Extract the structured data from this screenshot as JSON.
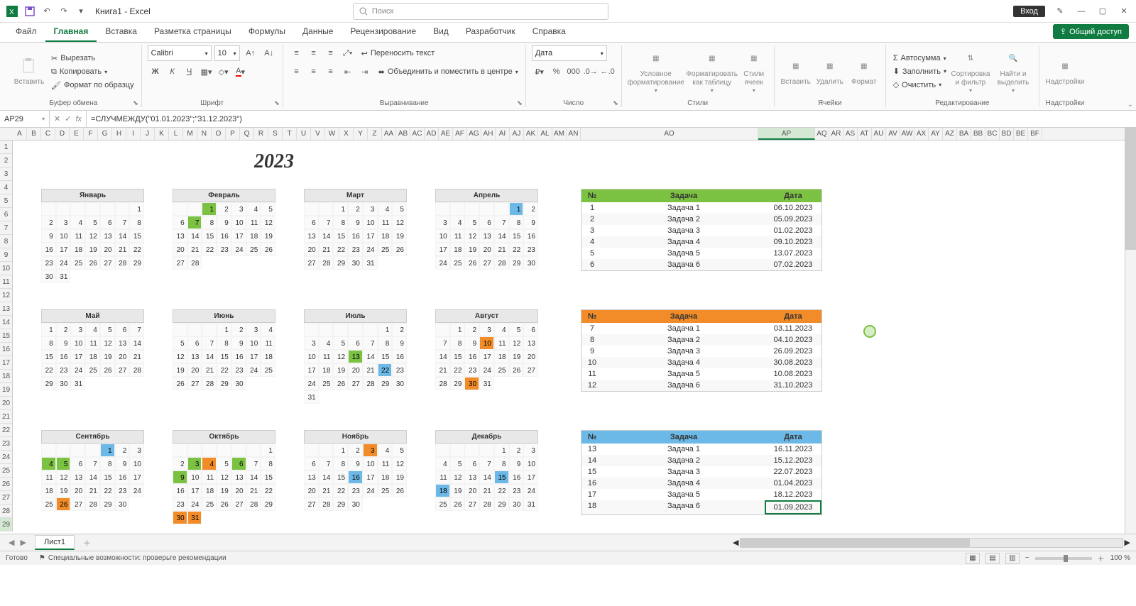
{
  "title": "Книга1 - Excel",
  "search_placeholder": "Поиск",
  "sign_in": "Вход",
  "tabs": [
    "Файл",
    "Главная",
    "Вставка",
    "Разметка страницы",
    "Формулы",
    "Данные",
    "Рецензирование",
    "Вид",
    "Разработчик",
    "Справка"
  ],
  "active_tab": "Главная",
  "share": "Общий доступ",
  "clipboard": {
    "paste": "Вставить",
    "cut": "Вырезать",
    "copy": "Копировать",
    "format_painter": "Формат по образцу",
    "label": "Буфер обмена"
  },
  "font": {
    "name": "Calibri",
    "size": "10",
    "label": "Шрифт"
  },
  "alignment": {
    "wrap": "Переносить текст",
    "merge": "Объединить и поместить в центре",
    "label": "Выравнивание"
  },
  "number": {
    "format": "Дата",
    "label": "Число"
  },
  "styles": {
    "conditional": "Условное форматирование",
    "table": "Форматировать как таблицу",
    "cell": "Стили ячеек",
    "label": "Стили"
  },
  "cells": {
    "insert": "Вставить",
    "delete": "Удалить",
    "format": "Формат",
    "label": "Ячейки"
  },
  "editing": {
    "autosum": "Автосумма",
    "fill": "Заполнить",
    "clear": "Очистить",
    "sort": "Сортировка и фильтр",
    "find": "Найти и выделить",
    "label": "Редактирование"
  },
  "addins": {
    "btn": "Надстройки",
    "label": "Надстройки"
  },
  "name_box": "AP29",
  "formula": "=СЛУЧМЕЖДУ(\"01.01.2023\";\"31.12.2023\")",
  "year": "2023",
  "col_letters_narrow": [
    "A",
    "B",
    "C",
    "D",
    "E",
    "F",
    "G",
    "H",
    "I",
    "J",
    "K",
    "L",
    "M",
    "N",
    "O",
    "P",
    "Q",
    "R",
    "S",
    "T",
    "U",
    "V",
    "W",
    "X",
    "Y",
    "Z",
    "AA",
    "AB",
    "AC",
    "AD",
    "AE",
    "AF",
    "AG",
    "AH",
    "AI",
    "AJ",
    "AK",
    "AL",
    "AM",
    "AN"
  ],
  "col_wide": [
    "AO",
    "AP"
  ],
  "col_after": [
    "AQ",
    "AR",
    "AS",
    "AT",
    "AU",
    "AV",
    "AW",
    "AX",
    "AY",
    "AZ",
    "BA",
    "BB",
    "BC",
    "BD",
    "BE",
    "BF"
  ],
  "active_col": "AP",
  "row_count": 29,
  "active_row": 29,
  "months": [
    {
      "name": "Январь",
      "start": 6,
      "days": 31,
      "hl": {}
    },
    {
      "name": "Февраль",
      "start": 2,
      "days": 28,
      "hl": {
        "1": "green",
        "7": "green"
      }
    },
    {
      "name": "Март",
      "start": 2,
      "days": 31,
      "hl": {}
    },
    {
      "name": "Апрель",
      "start": 5,
      "days": 30,
      "hl": {
        "1": "blue"
      }
    },
    {
      "name": "Май",
      "start": 0,
      "days": 31,
      "hl": {}
    },
    {
      "name": "Июнь",
      "start": 3,
      "days": 30,
      "hl": {}
    },
    {
      "name": "Июль",
      "start": 5,
      "days": 31,
      "hl": {
        "13": "green",
        "22": "blue"
      }
    },
    {
      "name": "Август",
      "start": 1,
      "days": 31,
      "hl": {
        "10": "orange",
        "30": "orange"
      }
    },
    {
      "name": "Сентябрь",
      "start": 4,
      "days": 30,
      "hl": {
        "1": "blue",
        "4": "green",
        "5": "green",
        "26": "orange"
      }
    },
    {
      "name": "Октябрь",
      "start": 6,
      "days": 31,
      "hl": {
        "3": "green",
        "4": "orange",
        "6": "green",
        "9": "green",
        "30": "orange",
        "31": "orange"
      }
    },
    {
      "name": "Ноябрь",
      "start": 2,
      "days": 30,
      "hl": {
        "3": "orange",
        "16": "blue"
      }
    },
    {
      "name": "Декабрь",
      "start": 4,
      "days": 31,
      "hl": {
        "15": "blue",
        "18": "blue"
      }
    }
  ],
  "task_headers": {
    "num": "№",
    "task": "Задача",
    "date": "Дата"
  },
  "task_tables": [
    {
      "color": "green",
      "rows": [
        {
          "n": "1",
          "t": "Задача 1",
          "d": "06.10.2023"
        },
        {
          "n": "2",
          "t": "Задача 2",
          "d": "05.09.2023"
        },
        {
          "n": "3",
          "t": "Задача 3",
          "d": "01.02.2023"
        },
        {
          "n": "4",
          "t": "Задача 4",
          "d": "09.10.2023"
        },
        {
          "n": "5",
          "t": "Задача 5",
          "d": "13.07.2023"
        },
        {
          "n": "6",
          "t": "Задача 6",
          "d": "07.02.2023"
        }
      ]
    },
    {
      "color": "orange",
      "rows": [
        {
          "n": "7",
          "t": "Задача 1",
          "d": "03.11.2023"
        },
        {
          "n": "8",
          "t": "Задача 2",
          "d": "04.10.2023"
        },
        {
          "n": "9",
          "t": "Задача 3",
          "d": "26.09.2023"
        },
        {
          "n": "10",
          "t": "Задача 4",
          "d": "30.08.2023"
        },
        {
          "n": "11",
          "t": "Задача 5",
          "d": "10.08.2023"
        },
        {
          "n": "12",
          "t": "Задача 6",
          "d": "31.10.2023"
        }
      ]
    },
    {
      "color": "blue",
      "rows": [
        {
          "n": "13",
          "t": "Задача 1",
          "d": "16.11.2023"
        },
        {
          "n": "14",
          "t": "Задача 2",
          "d": "15.12.2023"
        },
        {
          "n": "15",
          "t": "Задача 3",
          "d": "22.07.2023"
        },
        {
          "n": "16",
          "t": "Задача 4",
          "d": "01.04.2023"
        },
        {
          "n": "17",
          "t": "Задача 5",
          "d": "18.12.2023"
        },
        {
          "n": "18",
          "t": "Задача 6",
          "d": "01.09.2023"
        }
      ]
    }
  ],
  "sheet_name": "Лист1",
  "status_ready": "Готово",
  "status_accessibility": "Специальные возможности: проверьте рекомендации",
  "zoom": "100 %"
}
